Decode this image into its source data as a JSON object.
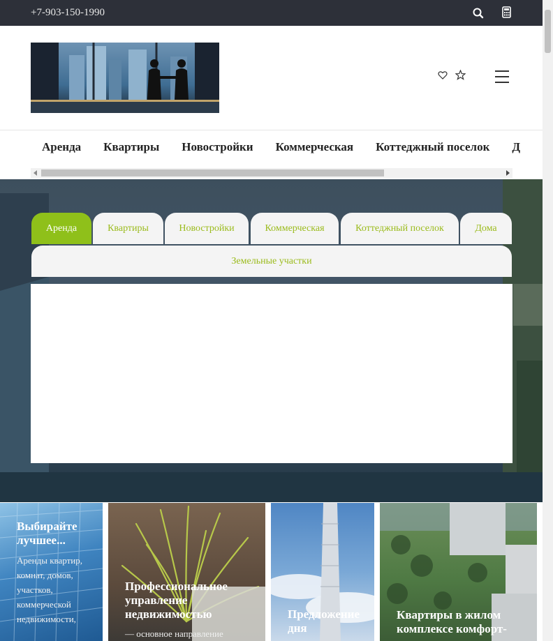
{
  "topbar": {
    "phone": "+7-903-150-1990",
    "search_icon": "search-icon",
    "calculator_icon": "calculator-icon"
  },
  "header": {
    "logo_icon": "logo-image",
    "favorites_icon": "heart-icon",
    "compare_icon": "star-icon",
    "menu_icon": "hamburger-icon"
  },
  "nav": {
    "items": [
      "Аренда",
      "Квартиры",
      "Новостройки",
      "Коммерческая",
      "Коттеджный поселок",
      "Д"
    ]
  },
  "search_tabs": {
    "tabs": [
      "Аренда",
      "Квартиры",
      "Новостройки",
      "Коммерческая",
      "Коттеджный поселок",
      "Дома"
    ],
    "second_row": "Земельные участки",
    "active_color": "#8fc01a",
    "text_color": "#9bbb1c"
  },
  "cards": [
    {
      "title": "Выбирайте лучшее...",
      "text": "Аренды квартир, комнат, домов, участков, коммерческой недвижимости,"
    },
    {
      "title": "Профессиональное управление недвижимостью",
      "text": "— основное направление"
    },
    {
      "title": "Предложение дня",
      "text": ""
    },
    {
      "title": "Квартиры в жилом комплексе комфорт-",
      "text": ""
    }
  ]
}
